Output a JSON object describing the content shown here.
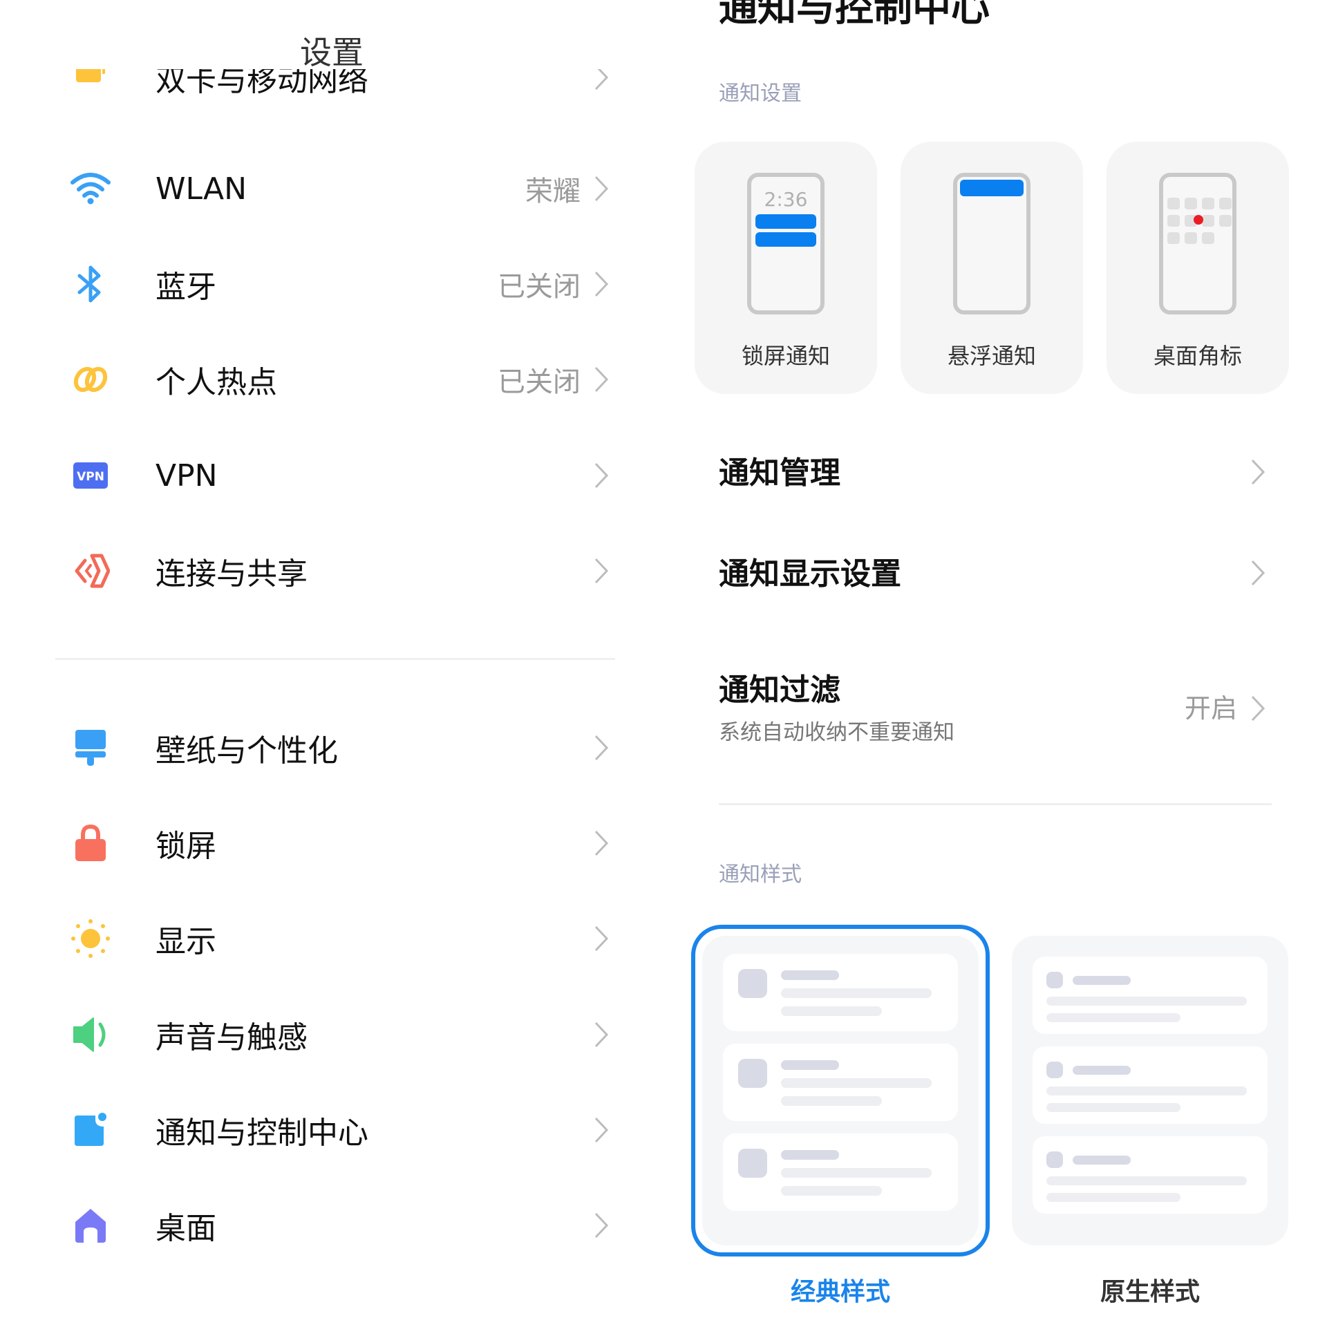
{
  "left_panel": {
    "title": "设置",
    "cut_row": {
      "label": "双卡与移动网络",
      "icon": "sim-card-icon",
      "icon_color": "#fdc33b"
    },
    "network_items": [
      {
        "label": "WLAN",
        "value": "荣耀",
        "icon": "wifi-icon",
        "icon_color": "#3aa0f5"
      },
      {
        "label": "蓝牙",
        "value": "已关闭",
        "icon": "bluetooth-icon",
        "icon_color": "#3aa0f5"
      },
      {
        "label": "个人热点",
        "value": "已关闭",
        "icon": "hotspot-icon",
        "icon_color": "#fdc33b"
      },
      {
        "label": "VPN",
        "value": "",
        "icon": "vpn-icon",
        "icon_color": "#4e6ef2",
        "icon_text": "VPN"
      },
      {
        "label": "连接与共享",
        "value": "",
        "icon": "connection-share-icon",
        "icon_color": "#f26b57"
      }
    ],
    "personal_items": [
      {
        "label": "壁纸与个性化",
        "value": "",
        "icon": "brush-icon",
        "icon_color": "#3aa0f5"
      },
      {
        "label": "锁屏",
        "value": "",
        "icon": "lock-icon",
        "icon_color": "#f8715f"
      },
      {
        "label": "显示",
        "value": "",
        "icon": "sun-icon",
        "icon_color": "#fdc33b"
      },
      {
        "label": "声音与触感",
        "value": "",
        "icon": "speaker-icon",
        "icon_color": "#4dd07f"
      },
      {
        "label": "通知与控制中心",
        "value": "",
        "icon": "notification-icon",
        "icon_color": "#33a8f7"
      },
      {
        "label": "桌面",
        "value": "",
        "icon": "home-icon",
        "icon_color": "#7b7af6"
      }
    ]
  },
  "right_panel": {
    "cut_title": "通知与控制中心",
    "section_notification_settings": "通知设置",
    "notification_types": [
      {
        "label": "锁屏通知",
        "preview_time": "2:36",
        "kind": "lockscreen"
      },
      {
        "label": "悬浮通知",
        "kind": "floating"
      },
      {
        "label": "桌面角标",
        "kind": "badge"
      }
    ],
    "items": [
      {
        "label": "通知管理"
      },
      {
        "label": "通知显示设置"
      },
      {
        "label": "通知过滤",
        "subtitle": "系统自动收纳不重要通知",
        "value": "开启"
      }
    ],
    "section_notification_style": "通知样式",
    "styles": [
      {
        "label": "经典样式",
        "selected": true
      },
      {
        "label": "原生样式",
        "selected": false
      }
    ],
    "accent_color": "#1a84ea"
  }
}
